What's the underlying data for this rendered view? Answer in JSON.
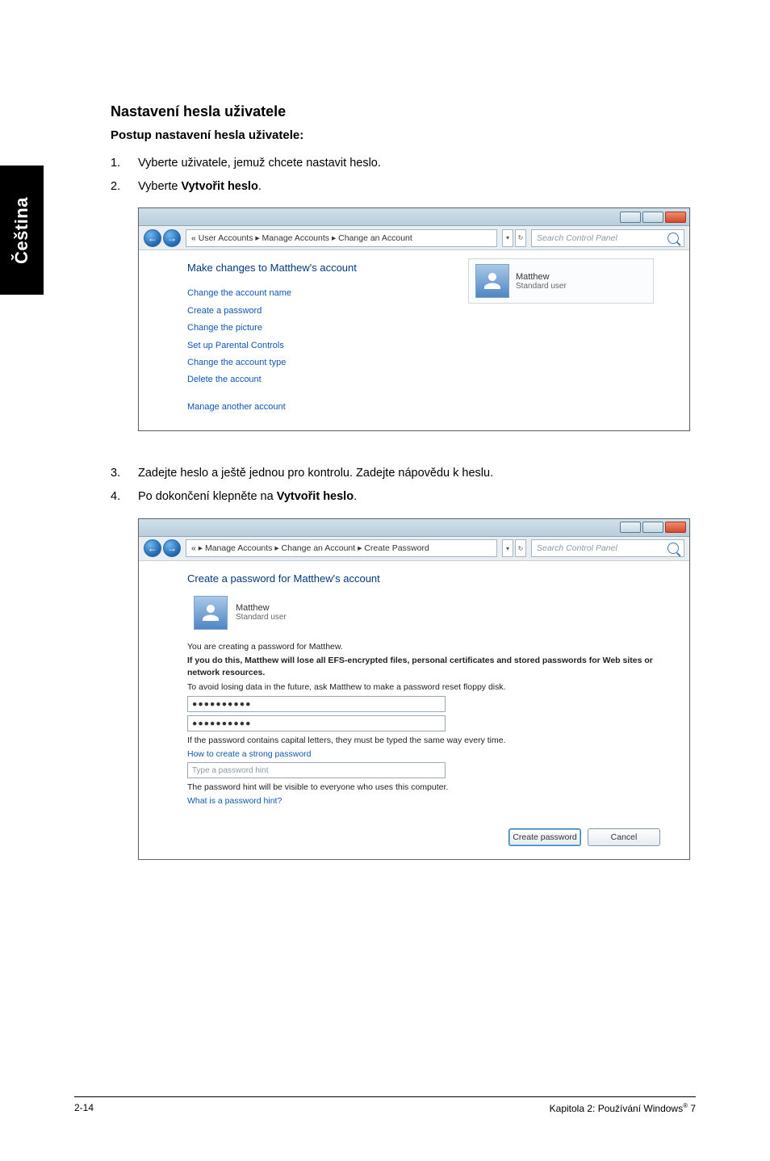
{
  "sidebar": {
    "label": "Čeština"
  },
  "headings": {
    "h2": "Nastavení hesla uživatele",
    "h3": "Postup nastavení hesla uživatele:"
  },
  "steps": {
    "s1": {
      "num": "1.",
      "text": "Vyberte uživatele, jemuž chcete nastavit heslo."
    },
    "s2": {
      "num": "2.",
      "text_prefix": "Vyberte ",
      "text_bold": "Vytvořit heslo",
      "text_suffix": "."
    },
    "s3": {
      "num": "3.",
      "text": "Zadejte heslo a ještě jednou pro kontrolu. Zadejte nápovědu k heslu."
    },
    "s4": {
      "num": "4.",
      "text_prefix": "Po dokončení klepněte na ",
      "text_bold": "Vytvořit heslo",
      "text_suffix": "."
    }
  },
  "window1": {
    "nav": {
      "back": "←",
      "forward": "→"
    },
    "breadcrumb": "« User Accounts  ▸ Manage Accounts  ▸ Change an Account",
    "search_placeholder": "Search Control Panel",
    "panel_title": "Make changes to Matthew's account",
    "links": {
      "l1": "Change the account name",
      "l2": "Create a password",
      "l3": "Change the picture",
      "l4": "Set up Parental Controls",
      "l5": "Change the account type",
      "l6": "Delete the account",
      "l7": "Manage another account"
    },
    "account": {
      "name": "Matthew",
      "type": "Standard user"
    }
  },
  "window2": {
    "breadcrumb": "«  ▸ Manage Accounts  ▸ Change an Account  ▸ Create Password",
    "search_placeholder": "Search Control Panel",
    "panel_title": "Create a password for Matthew's account",
    "account": {
      "name": "Matthew",
      "type": "Standard user"
    },
    "line_creating": "You are creating a password for Matthew.",
    "warn_bold": "If you do this, Matthew will lose all EFS-encrypted files, personal certificates and stored passwords for Web sites or network resources.",
    "warn_floppy": "To avoid losing data in the future, ask Matthew to make a password reset floppy disk.",
    "pw1": "●●●●●●●●●●",
    "pw2": "●●●●●●●●●●",
    "caps_hint": "If the password contains capital letters, they must be typed the same way every time.",
    "help_link": "How to create a strong password",
    "hint_placeholder": "Type a password hint",
    "hint_visible": "The password hint will be visible to everyone who uses this computer.",
    "hint_link": "What is a password hint?",
    "buttons": {
      "create": "Create password",
      "cancel": "Cancel"
    }
  },
  "footer": {
    "left": "2-14",
    "right_prefix": "Kapitola 2: Používání Windows",
    "right_sup": "®",
    "right_suffix": " 7"
  }
}
